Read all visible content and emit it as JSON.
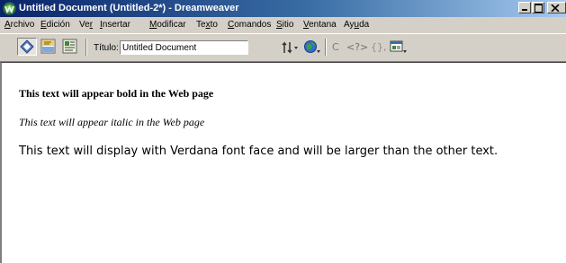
{
  "window": {
    "title": "Untitled Document (Untitled-2*) - Dreamweaver"
  },
  "menubar": {
    "items": [
      {
        "mnemonic": "A",
        "rest": "rchivo"
      },
      {
        "mnemonic": "E",
        "rest": "dición"
      },
      {
        "pre": "Ve",
        "mnemonic": "r",
        "rest": ""
      },
      {
        "mnemonic": "I",
        "rest": "nsertar"
      },
      {
        "mnemonic": "M",
        "rest": "odificar"
      },
      {
        "pre": "Te",
        "mnemonic": "x",
        "rest": "to"
      },
      {
        "mnemonic": "C",
        "rest": "omandos"
      },
      {
        "mnemonic": "S",
        "rest": "itio"
      },
      {
        "mnemonic": "V",
        "rest": "entana"
      },
      {
        "pre": "Ay",
        "mnemonic": "u",
        "rest": "da"
      }
    ]
  },
  "toolbar": {
    "title_label": "Título:",
    "title_value": "Untitled Document",
    "glyph_refresh": "C",
    "glyph_tag": "<?>",
    "glyph_braces": "{},"
  },
  "document": {
    "bold_text": "This text will appear bold in the Web page",
    "italic_text": "This text will appear italic in the Web page",
    "verdana_text": "This text will display with Verdana font face and will be larger than the other text."
  },
  "icons": {
    "app": "dreamweaver-logo-icon",
    "code_view": "code-view-icon",
    "split_view": "code-and-design-view-icon",
    "design_view": "design-view-icon",
    "file_management": "file-management-icon",
    "preview": "preview-in-browser-icon",
    "refresh": "refresh-icon",
    "reference": "reference-icon",
    "nav_options": "code-navigation-icon",
    "view_options": "view-options-icon"
  },
  "colors": {
    "titlebar_start": "#0a246a",
    "titlebar_end": "#a6caf0",
    "chrome": "#d4d0c8"
  }
}
